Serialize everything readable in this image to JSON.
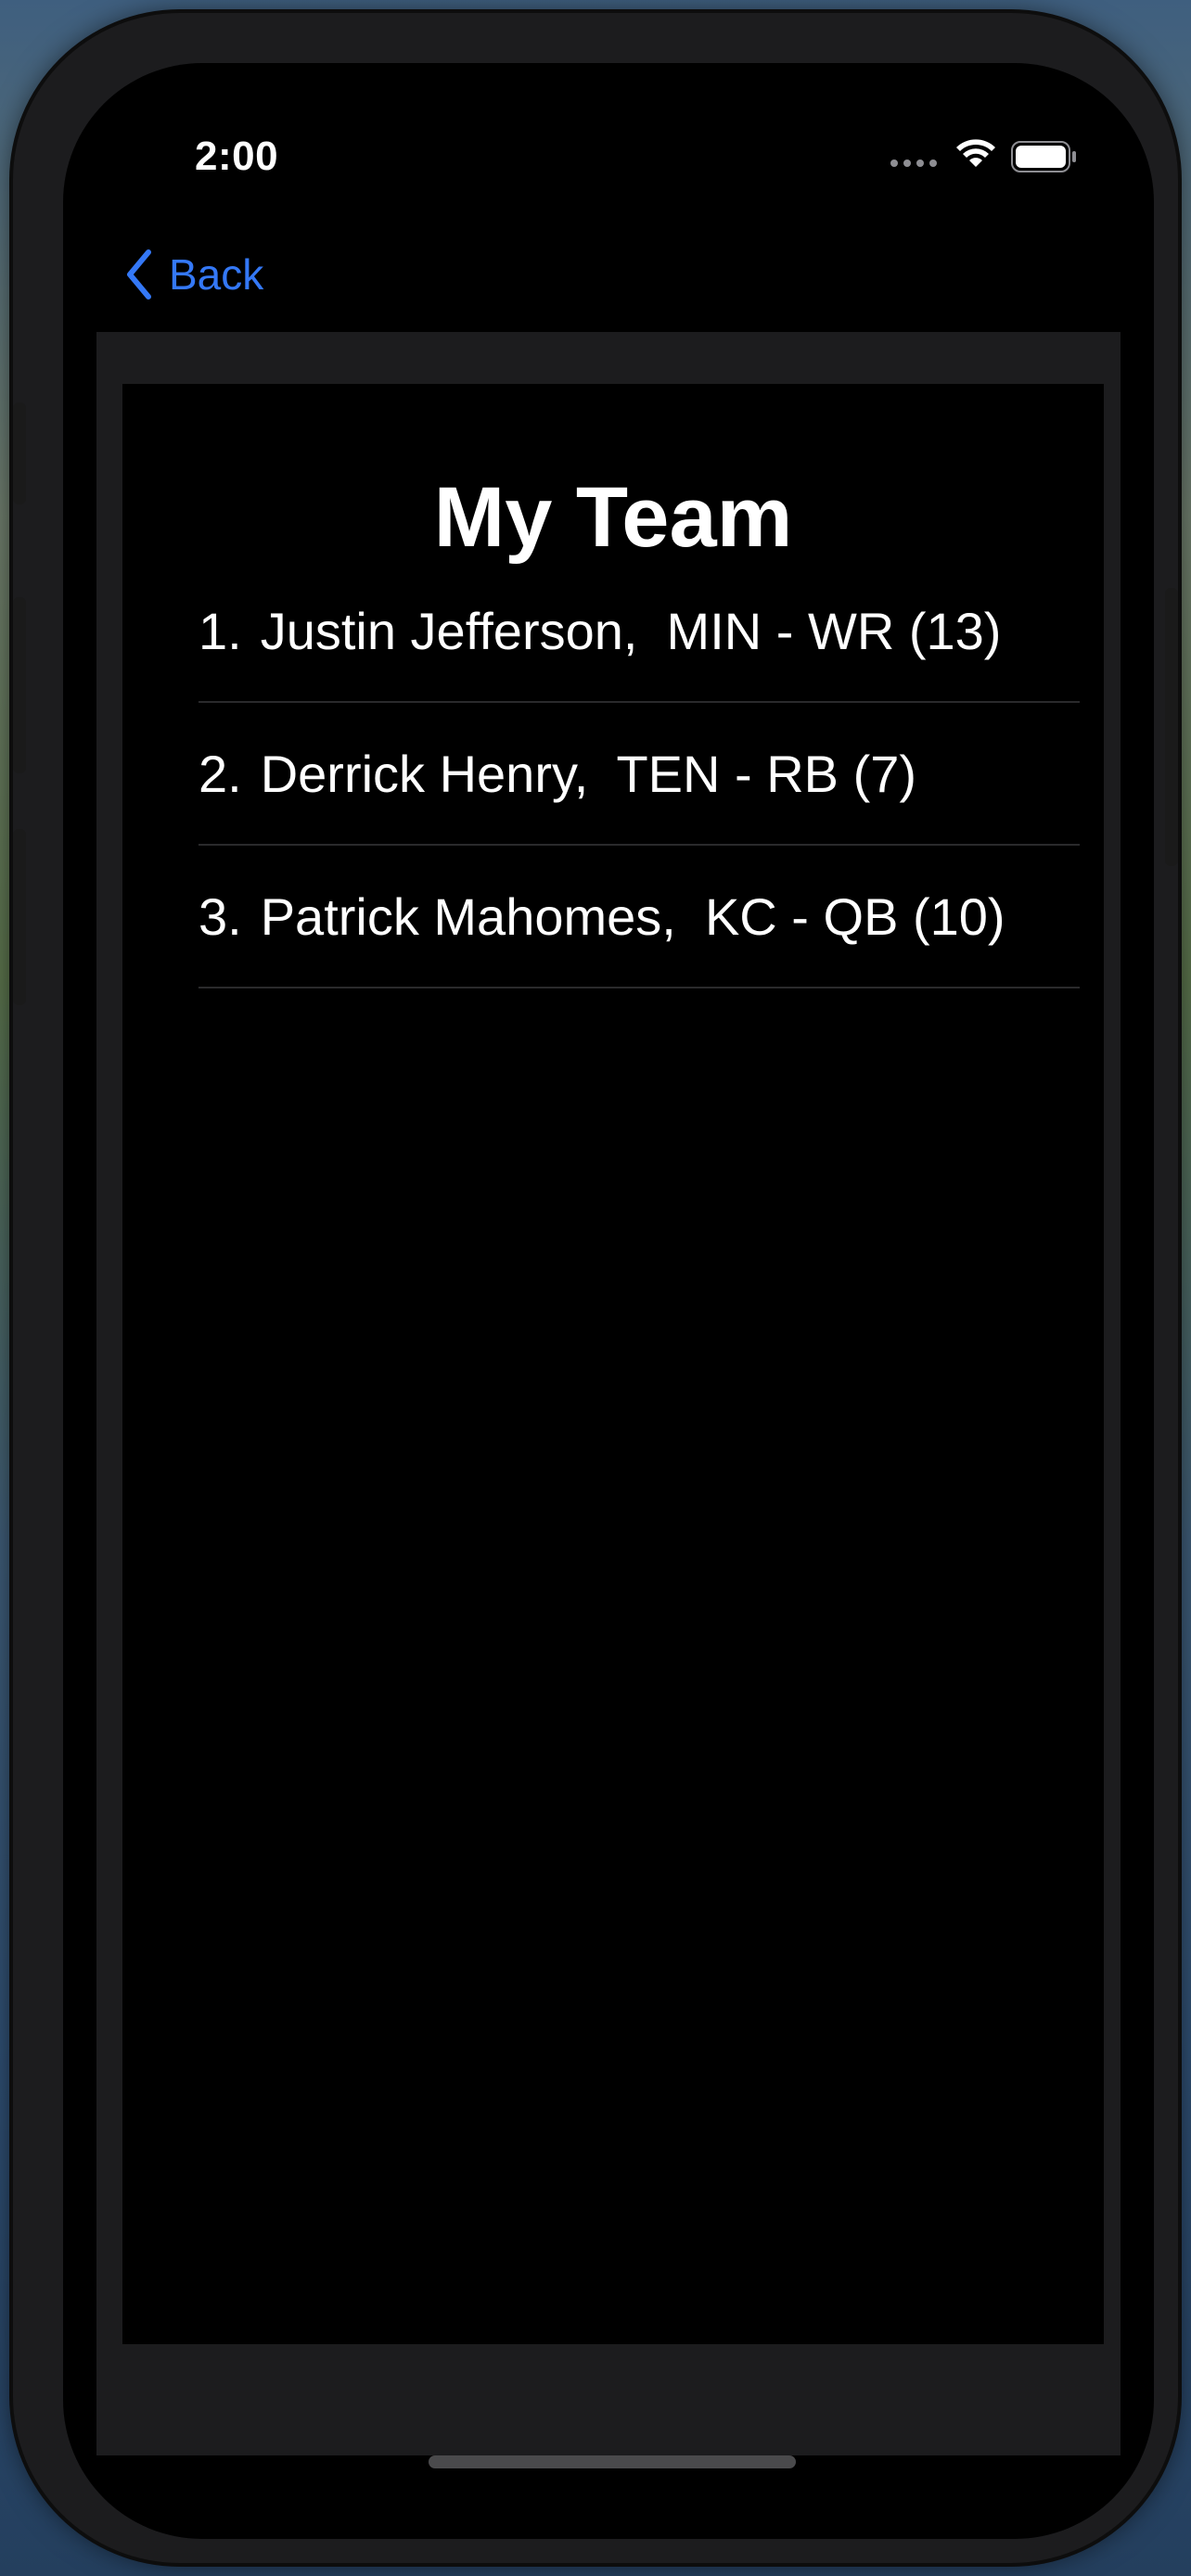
{
  "status_bar": {
    "time": "2:00",
    "signal_icon": "cellular-dots-icon",
    "wifi_icon": "wifi-icon",
    "battery_icon": "battery-icon"
  },
  "nav": {
    "back_label": "Back",
    "back_icon": "chevron-left-icon"
  },
  "page": {
    "title": "My Team"
  },
  "team": [
    {
      "number": "1.",
      "text": "Justin Jefferson,  MIN - WR (13)"
    },
    {
      "number": "2.",
      "text": "Derrick Henry,  TEN - RB (7)"
    },
    {
      "number": "3.",
      "text": "Patrick Mahomes,  KC - QB (10)"
    }
  ],
  "colors": {
    "accent": "#3478f6",
    "background": "#000000",
    "sheet": "#1c1c1e",
    "separator": "#2a2a2c",
    "text": "#ffffff"
  }
}
